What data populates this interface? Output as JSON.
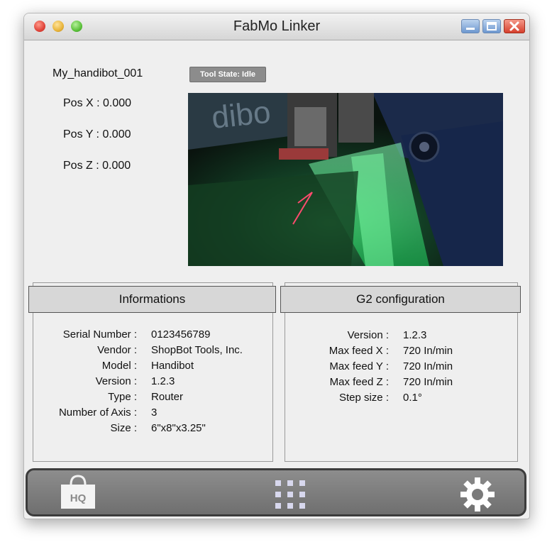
{
  "window": {
    "title": "FabMo Linker"
  },
  "device": {
    "name": "My_handibot_001",
    "pos_x": "Pos X : 0.000",
    "pos_y": "Pos Y : 0.000",
    "pos_z": "Pos Z : 0.000",
    "tool_state": "Tool State: Idle"
  },
  "camera": {
    "overlay_text": "dibo"
  },
  "informations": {
    "title": "Informations",
    "rows": [
      {
        "label": "Serial Number :",
        "value": "0123456789"
      },
      {
        "label": "Vendor :",
        "value": "ShopBot Tools, Inc."
      },
      {
        "label": "Model :",
        "value": "Handibot"
      },
      {
        "label": "Version :",
        "value": "1.2.3"
      },
      {
        "label": "Type :",
        "value": "Router"
      },
      {
        "label": "Number of Axis :",
        "value": "3"
      },
      {
        "label": "Size :",
        "value": "6\"x8\"x3.25\""
      }
    ]
  },
  "g2": {
    "title": "G2 configuration",
    "rows": [
      {
        "label": "Version :",
        "value": "1.2.3"
      },
      {
        "label": "Max feed X :",
        "value": "720 In/min"
      },
      {
        "label": "Max feed Y :",
        "value": "720 In/min"
      },
      {
        "label": "Max feed Z :",
        "value": "720 In/min"
      },
      {
        "label": "Step size :",
        "value": "0.1°"
      }
    ]
  },
  "toolbar": {
    "hq_label": "HQ",
    "hq_icon": "hq-bag-icon",
    "apps_icon": "apps-grid-icon",
    "settings_icon": "gear-icon"
  }
}
